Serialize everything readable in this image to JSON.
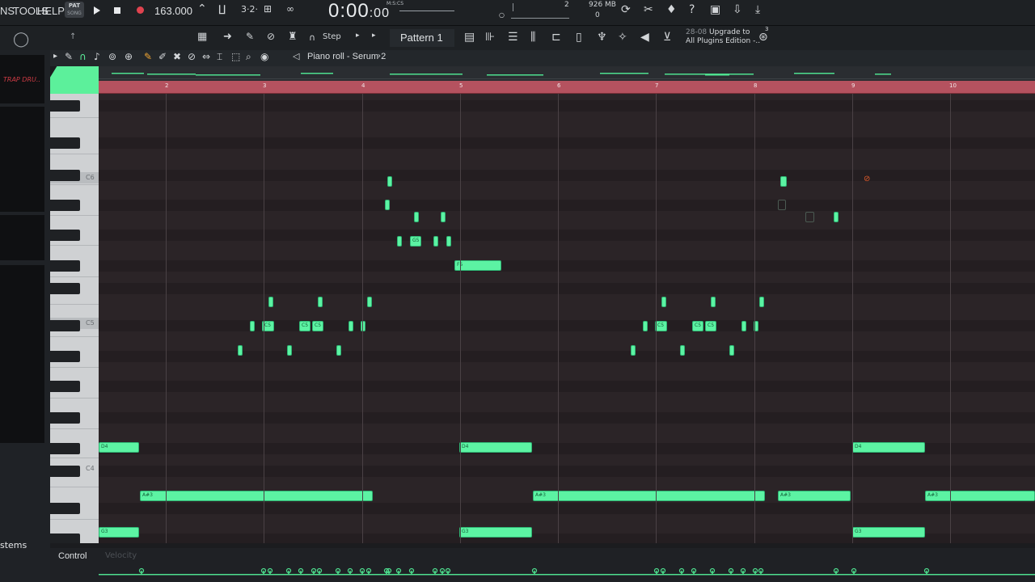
{
  "menu": {
    "items": [
      "NS",
      "TOOLS",
      "HELP"
    ]
  },
  "pat_song": {
    "pat": "PAT",
    "song": "SONG"
  },
  "transport": {
    "tempo": "163.000",
    "time": "0:00",
    "time_small": ":00",
    "time_format": "M:S:CS"
  },
  "system": {
    "mem": "926 MB",
    "voices": "0",
    "channel": "2"
  },
  "pattern": {
    "name": "Pattern 1",
    "snap": "Step"
  },
  "upgrade": {
    "date": "28-08",
    "line1": "Upgrade to",
    "line2": "All Plugins Edition -..",
    "badge": "3"
  },
  "piano_roll": {
    "title": "Piano roll - Serum 2"
  },
  "browser": {
    "section": "TRAP DRU..",
    "footer": "stems"
  },
  "ruler": {
    "bars": [
      "2",
      "3",
      "4",
      "5",
      "6",
      "7",
      "8",
      "9",
      "10"
    ]
  },
  "keyboard": {
    "labels": [
      "C6",
      "C5",
      "C4"
    ]
  },
  "control": {
    "label": "Control",
    "param": "Velocity"
  },
  "colors": {
    "note": "#5cf3a3",
    "ruler": "#b5525f",
    "accent": "#5cf09b"
  },
  "notes": [
    {
      "label": ""
    },
    {
      "label": ""
    },
    {
      "label": ""
    },
    {
      "label": ""
    },
    {
      "label": ""
    },
    {
      "label": "G5"
    },
    {
      "label": ""
    },
    {
      "label": ""
    },
    {
      "label": "F5"
    },
    {
      "label": ""
    },
    {
      "label": ""
    },
    {
      "label": ""
    },
    {
      "label": ""
    },
    {
      "label": "C5"
    },
    {
      "label": "C5"
    },
    {
      "label": "C5"
    },
    {
      "label": ""
    },
    {
      "label": ""
    },
    {
      "label": ""
    },
    {
      "label": ""
    },
    {
      "label": ""
    },
    {
      "label": ""
    },
    {
      "label": ""
    },
    {
      "label": ""
    },
    {
      "label": ""
    },
    {
      "label": "C5"
    },
    {
      "label": "C5"
    },
    {
      "label": "C5"
    },
    {
      "label": ""
    },
    {
      "label": ""
    },
    {
      "label": ""
    },
    {
      "label": ""
    },
    {
      "label": ""
    },
    {
      "label": ""
    },
    {
      "label": ""
    },
    {
      "label": "D4"
    },
    {
      "label": "D4"
    },
    {
      "label": "D4"
    },
    {
      "label": "A#3"
    },
    {
      "label": "A#3"
    },
    {
      "label": "A#3"
    },
    {
      "label": "A#3"
    },
    {
      "label": "G3"
    },
    {
      "label": "G3"
    },
    {
      "label": "G3"
    }
  ]
}
